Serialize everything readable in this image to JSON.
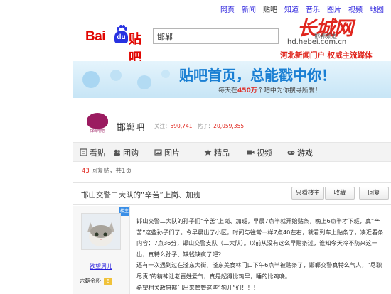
{
  "topnav": {
    "items": [
      {
        "label": "网页",
        "current": false
      },
      {
        "label": "新闻",
        "current": false
      },
      {
        "label": "贴吧",
        "current": true
      },
      {
        "label": "知道",
        "current": false
      },
      {
        "label": "音乐",
        "current": false
      },
      {
        "label": "图片",
        "current": false
      },
      {
        "label": "视频",
        "current": false
      },
      {
        "label": "地图",
        "current": false
      }
    ]
  },
  "logo": {
    "bai": "Bai",
    "du": "du",
    "tieba": "贴吧"
  },
  "search": {
    "value": "邯郸"
  },
  "watermark": {
    "brand": "长城网",
    "channel": "邯郸频道",
    "url": "hd.hebei.com.cn",
    "slogan": "河北新闻门户  权威主流媒体"
  },
  "banner": {
    "main": "贴吧首页，总能戳中你！",
    "sub_prefix": "每天在",
    "sub_count": "450万",
    "sub_suffix": "个吧中为你搜寻所爱！"
  },
  "forum": {
    "avatar_text": "邯郸吧吧",
    "name": "邯郸吧",
    "follow_label": "关注：",
    "follow_count": "590,741",
    "posts_label": "帖子：",
    "posts_count": "20,059,355"
  },
  "tabs": [
    {
      "icon": "list-icon",
      "label": "看贴"
    },
    {
      "icon": "group-icon",
      "label": "团购"
    },
    {
      "icon": "picture-icon",
      "label": "图片"
    },
    {
      "icon": "star-icon",
      "label": "精品"
    },
    {
      "icon": "video-icon",
      "label": "视频"
    },
    {
      "icon": "game-icon",
      "label": "游戏"
    }
  ],
  "pager": {
    "count": "43",
    "text": "回复贴，共1页"
  },
  "thread": {
    "title": "邯山交警二大队的“辛苦”上岗、加班",
    "only_author": "只看楼主",
    "collect": "收藏",
    "reply": "回复"
  },
  "post": {
    "louzhu": "楼主",
    "author": "欲望周儿",
    "level_name": "六朝金粉",
    "level": "6",
    "lines": [
      "邯山交警二大队的孙子们“辛苦”上岗、加班，早晨7点半就开始贴条，晚上6点半才下班，真“辛苦”这些孙子们了。今早晨出了小区，时间与往常一样7点40左右，就看到车上贴条了，凑近看条内容：7点36分，邯山交警支队（二大队）。以前从没有这么早贴条过，谁知今天冷不防来这一出，真特么孙子、缺钱缺疯了吧？",
      "还有一次遇到过在滏东大街，滏东美食林门口下午6点半被贴条了，邯郸交警真特么气人，“尽职尽责”的精神让老百姓爱气，真是起得比鸡早，睡的比鸡晚。",
      "希望相关政府部门出来管管这些“狗儿”们！！！"
    ]
  },
  "colors": {
    "accent": "#261cdc",
    "brand_red": "#e10601",
    "banner_blue": "#1a7fd3"
  }
}
